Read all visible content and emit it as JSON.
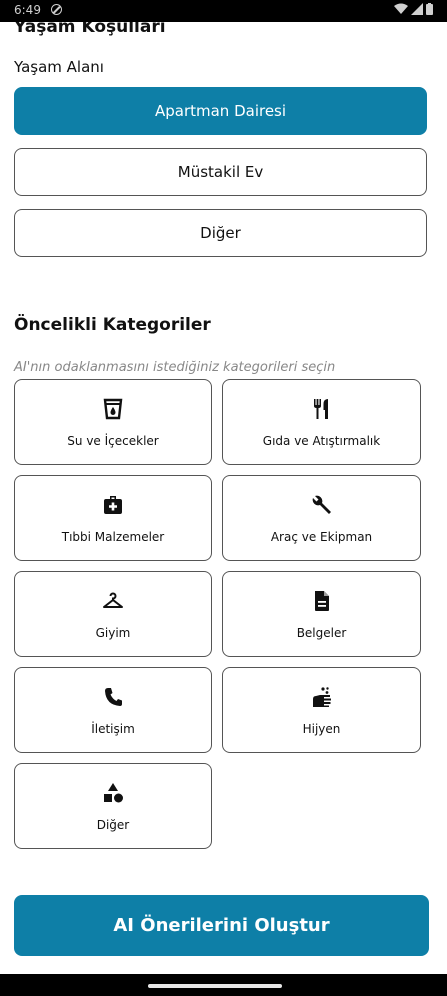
{
  "status_bar": {
    "time": "6:49"
  },
  "living": {
    "section_title": "Yaşam Koşulları",
    "label": "Yaşam Alanı",
    "options": [
      {
        "label": "Apartman Dairesi",
        "selected": true
      },
      {
        "label": "Müstakil Ev",
        "selected": false
      },
      {
        "label": "Diğer",
        "selected": false
      }
    ]
  },
  "categories": {
    "title": "Öncelikli Kategoriler",
    "hint": "AI'nın odaklanmasını istediğiniz kategorileri seçin",
    "items": [
      {
        "label": "Su ve İçecekler",
        "icon": "water-cup-icon"
      },
      {
        "label": "Gıda ve Atıştırmalık",
        "icon": "utensils-icon"
      },
      {
        "label": "Tıbbi Malzemeler",
        "icon": "medical-kit-icon"
      },
      {
        "label": "Araç ve Ekipman",
        "icon": "wrench-icon"
      },
      {
        "label": "Giyim",
        "icon": "hanger-icon"
      },
      {
        "label": "Belgeler",
        "icon": "document-icon"
      },
      {
        "label": "İletişim",
        "icon": "phone-icon"
      },
      {
        "label": "Hijyen",
        "icon": "soap-hands-icon"
      },
      {
        "label": "Diğer",
        "icon": "shapes-icon"
      }
    ]
  },
  "cta": {
    "label": "AI Önerilerini Oluştur"
  },
  "colors": {
    "accent": "#0e7fa7"
  }
}
